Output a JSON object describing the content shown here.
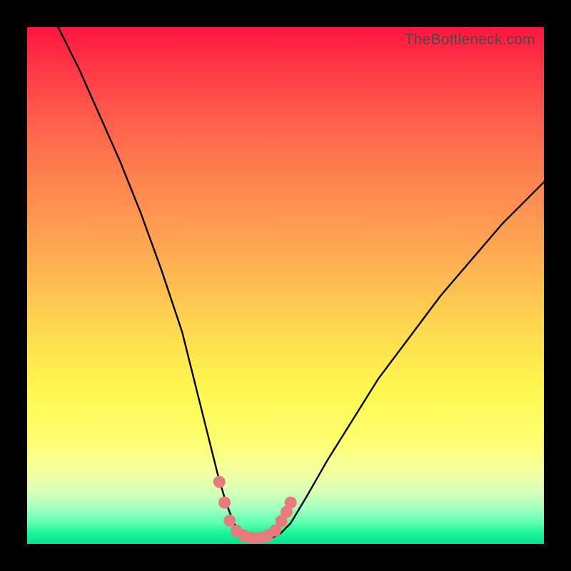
{
  "watermark": "TheBottleneck.com",
  "chart_data": {
    "type": "line",
    "title": "",
    "xlabel": "",
    "ylabel": "",
    "xlim": [
      0,
      100
    ],
    "ylim": [
      0,
      100
    ],
    "series": [
      {
        "name": "bottleneck-curve",
        "x": [
          6,
          10,
          14,
          18,
          22,
          26,
          30,
          33,
          35,
          37,
          38.5,
          40,
          41.5,
          43,
          44.5,
          46,
          47.5,
          49,
          51,
          54,
          58,
          63,
          68,
          74,
          80,
          86,
          92,
          98,
          100
        ],
        "values": [
          100,
          92,
          83,
          74,
          64,
          53,
          41,
          29,
          21,
          13,
          8,
          4,
          2,
          1.2,
          1,
          1,
          1.2,
          2,
          4,
          9,
          16,
          24,
          32,
          40,
          48,
          55,
          62,
          68,
          70
        ]
      }
    ],
    "markers": {
      "name": "highlight-dots",
      "color": "#e77b7b",
      "x": [
        37.2,
        38.2,
        39.2,
        40.5,
        42.0,
        43.5,
        45.0,
        46.5,
        48.0,
        49.2,
        50.2,
        51.0
      ],
      "values": [
        12.0,
        8.0,
        4.5,
        2.5,
        1.6,
        1.2,
        1.2,
        1.6,
        2.6,
        4.4,
        6.2,
        8.0
      ]
    },
    "background_gradient": {
      "top": "#ff163f",
      "middle": "#fff750",
      "bottom": "#08e08c"
    }
  }
}
